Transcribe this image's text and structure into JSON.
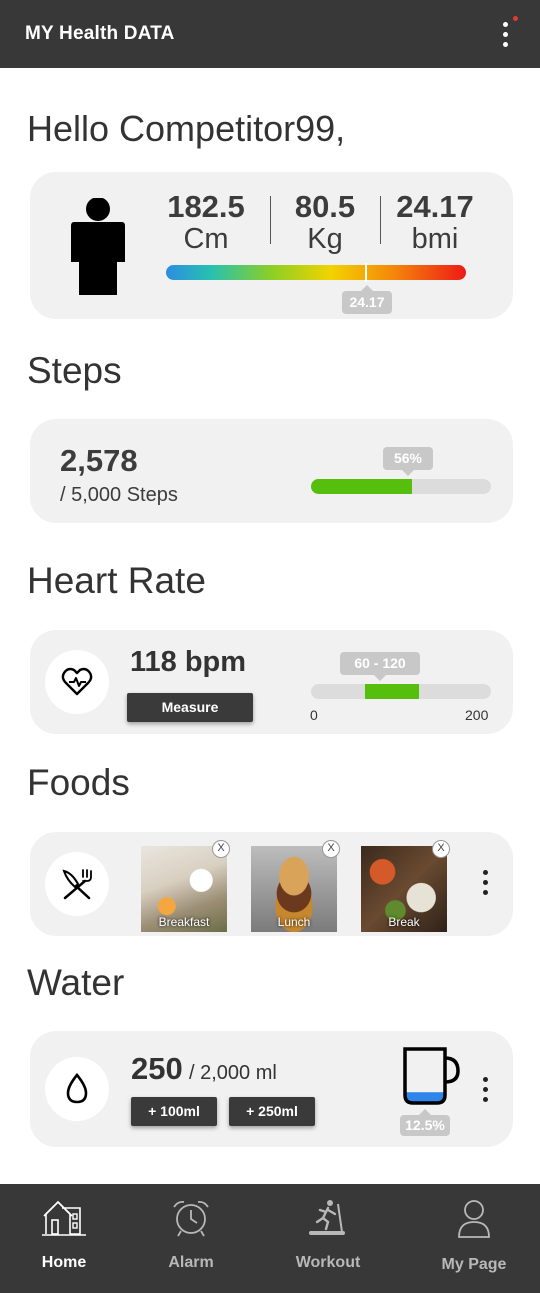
{
  "app": {
    "title": "MY Health DATA"
  },
  "greeting": "Hello Competitor99,",
  "body": {
    "height_value": "182.5",
    "height_unit": "Cm",
    "weight_value": "80.5",
    "weight_unit": "Kg",
    "bmi_value": "24.17",
    "bmi_unit": "bmi",
    "bmi_marker": "24.17"
  },
  "steps": {
    "title": "Steps",
    "count": "2,578",
    "goal": "/ 5,000 Steps",
    "percent_label": "56%",
    "progress": 0.56
  },
  "heart": {
    "title": "Heart Rate",
    "value": "118 bpm",
    "measure_label": "Measure",
    "range_label": "60 - 120",
    "scale_min": "0",
    "scale_max": "200",
    "range_low": 60,
    "range_high": 120
  },
  "foods": {
    "title": "Foods",
    "items": [
      {
        "label": "Breakfast",
        "remove": "X"
      },
      {
        "label": "Lunch",
        "remove": "X"
      },
      {
        "label": "Break",
        "remove": "X"
      }
    ]
  },
  "water": {
    "title": "Water",
    "amount": "250",
    "goal": "/ 2,000 ml",
    "add_100": "+ 100ml",
    "add_250": "+ 250ml",
    "percent_label": "12.5%",
    "progress": 0.125
  },
  "tabs": [
    {
      "label": "Home",
      "icon": "home-icon",
      "active": true
    },
    {
      "label": "Alarm",
      "icon": "alarm-icon",
      "active": false
    },
    {
      "label": "Workout",
      "icon": "treadmill-icon",
      "active": false
    },
    {
      "label": "My Page",
      "icon": "user-icon",
      "active": false
    }
  ],
  "colors": {
    "bar": "#383838",
    "green": "#56bf0e",
    "card": "#f1f1f1",
    "tooltip": "#c8c8c8"
  }
}
